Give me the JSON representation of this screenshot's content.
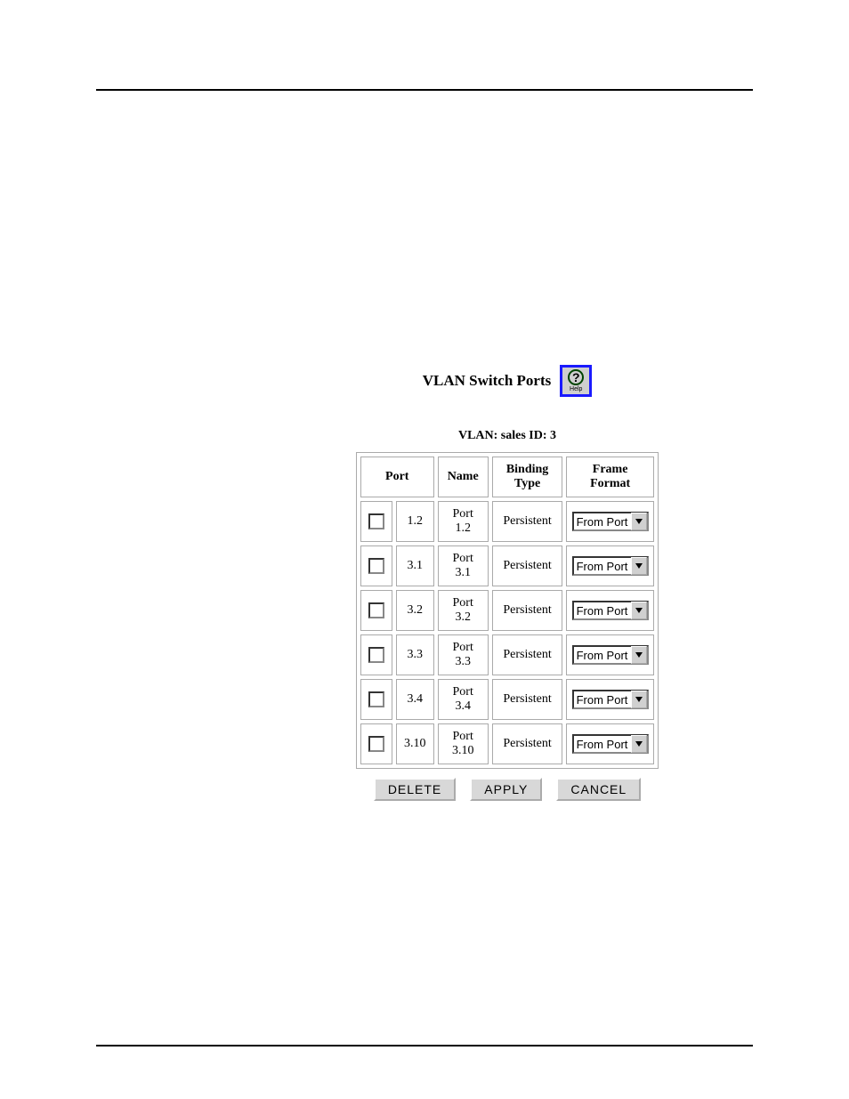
{
  "figure": {
    "title": "VLAN Switch Ports",
    "help_label": "Help",
    "subtitle": "VLAN: sales ID: 3",
    "headers": {
      "port": "Port",
      "name": "Name",
      "binding": "Binding Type",
      "frame": "Frame Format"
    },
    "rows": [
      {
        "port": "1.2",
        "name": "Port 1.2",
        "binding": "Persistent",
        "frame": "From Port"
      },
      {
        "port": "3.1",
        "name": "Port 3.1",
        "binding": "Persistent",
        "frame": "From Port"
      },
      {
        "port": "3.2",
        "name": "Port 3.2",
        "binding": "Persistent",
        "frame": "From Port"
      },
      {
        "port": "3.3",
        "name": "Port 3.3",
        "binding": "Persistent",
        "frame": "From Port"
      },
      {
        "port": "3.4",
        "name": "Port 3.4",
        "binding": "Persistent",
        "frame": "From Port"
      },
      {
        "port": "3.10",
        "name": "Port 3.10",
        "binding": "Persistent",
        "frame": "From Port"
      }
    ],
    "buttons": {
      "delete": "DELETE",
      "apply": "APPLY",
      "cancel": "CANCEL"
    }
  }
}
